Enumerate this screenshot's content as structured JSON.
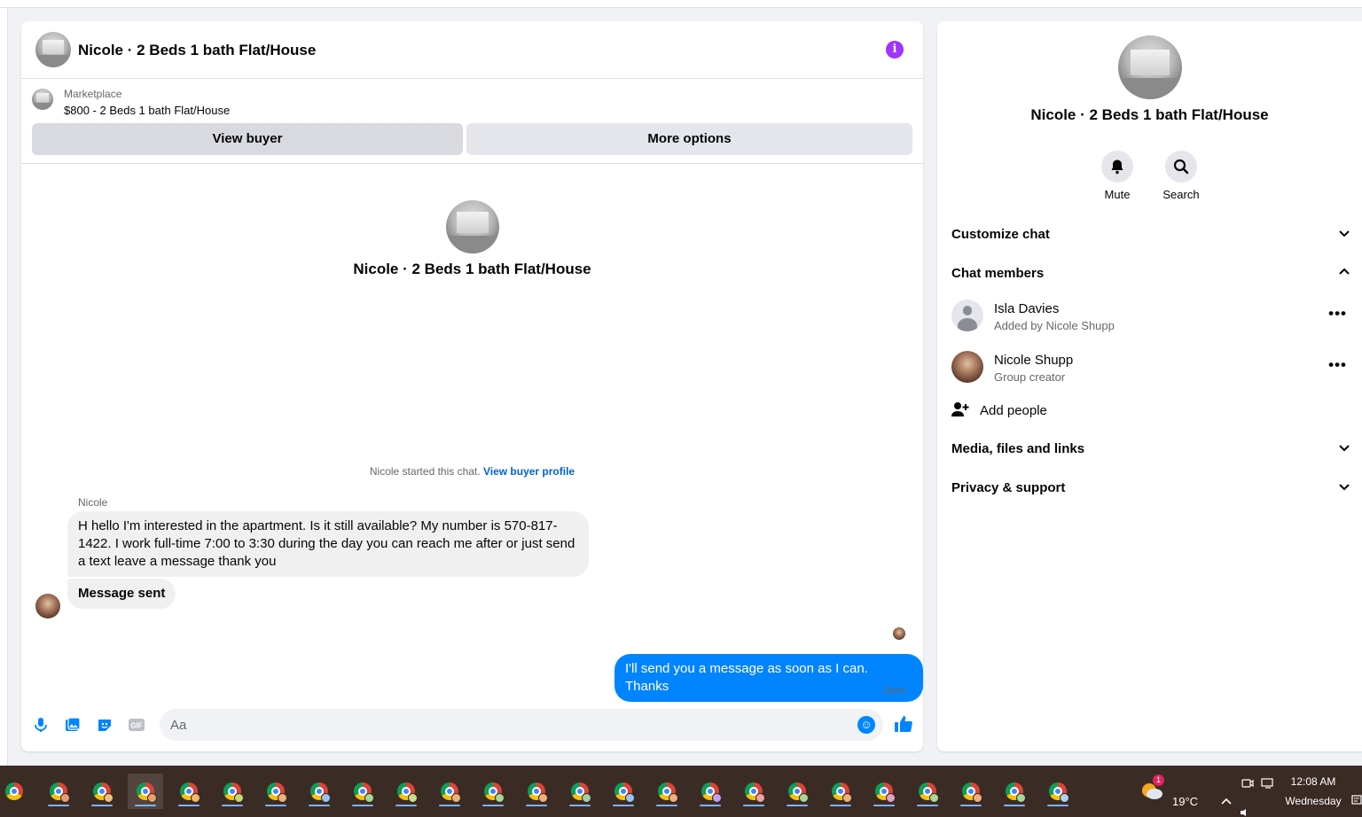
{
  "chat": {
    "header_title": "Nicole · 2 Beds 1 bath Flat/House",
    "listing": {
      "source": "Marketplace",
      "price_title": "$800 - 2 Beds 1 bath Flat/House",
      "view_buyer_label": "View buyer",
      "more_options_label": "More options"
    },
    "center_name": "Nicole · 2 Beds 1 bath Flat/House",
    "started_text": "Nicole started this chat.",
    "view_buyer_profile_label": "View buyer profile",
    "sender_label": "Nicole",
    "messages": [
      {
        "from": "Nicole",
        "text": "H hello I'm interested in the apartment. Is it still available? My number is 570-817-1422. I work full-time 7:00 to 3:30 during the day you can reach me after or just send a text leave a message thank you"
      },
      {
        "from": "Nicole",
        "text": "Message sent"
      },
      {
        "from": "me",
        "text": "I'll send you a message as soon as I can. Thanks"
      }
    ],
    "sent_status": "Sent",
    "composer": {
      "placeholder": "Aa",
      "gif_label": "GIF"
    }
  },
  "details": {
    "name": "Nicole · 2 Beds 1 bath Flat/House",
    "mute_label": "Mute",
    "search_label": "Search",
    "sections": {
      "customize": "Customize chat",
      "members": "Chat members",
      "media": "Media, files and links",
      "privacy": "Privacy & support"
    },
    "members": [
      {
        "name": "Isla Davies",
        "sub": "Added by Nicole Shupp"
      },
      {
        "name": "Nicole Shupp",
        "sub": "Group creator"
      }
    ],
    "add_people_label": "Add people"
  },
  "taskbar": {
    "weather_temp": "19°C",
    "weather_badge": "1",
    "time": "12:08 AM",
    "day": "Wednesday"
  },
  "colors": {
    "accent": "#0084ff",
    "info": "#a033ff",
    "link": "#0064d1"
  }
}
